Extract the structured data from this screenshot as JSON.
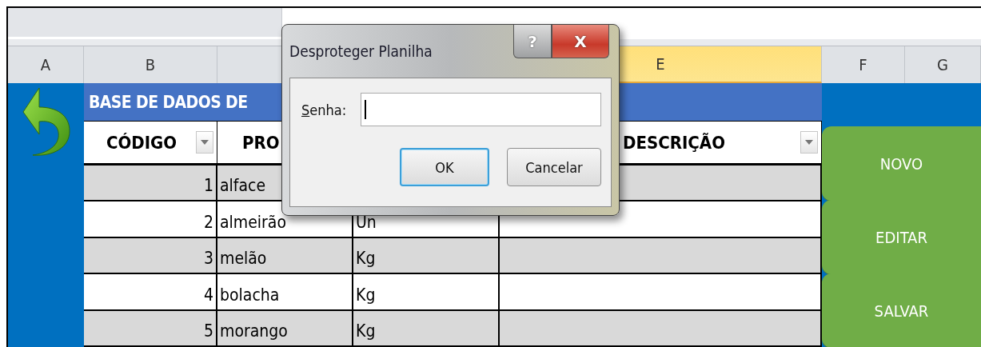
{
  "column_headers": [
    {
      "label": "A",
      "selected": false
    },
    {
      "label": "B",
      "selected": false
    },
    {
      "label": "E",
      "selected": true
    },
    {
      "label": "F",
      "selected": false
    },
    {
      "label": "G",
      "selected": false
    }
  ],
  "sheet": {
    "title": "BASE DE DADOS DE",
    "header": [
      {
        "label": "CÓDIGO",
        "filter": true
      },
      {
        "label": "PRO"
      },
      {
        "label": "DESCRIÇÃO",
        "filter": true
      }
    ],
    "rows": [
      {
        "code": "1",
        "product": "alface"
      },
      {
        "code": "2",
        "product": "almeirão",
        "unit": "Un"
      },
      {
        "code": "3",
        "product": "melão",
        "unit": "Kg"
      },
      {
        "code": "4",
        "product": "bolacha",
        "unit": "Kg"
      },
      {
        "code": "5",
        "product": "morango",
        "unit": "Kg"
      }
    ]
  },
  "buttons": [
    "NOVO",
    "EDITAR",
    "SALVAR"
  ],
  "dialog": {
    "title": "Desproteger Planilha",
    "help_button": "?",
    "close_button": "X",
    "field": {
      "label": "Senha:",
      "focused": true
    },
    "buttons": [
      {
        "label": "OK",
        "default": true
      },
      {
        "label": "Cancelar",
        "default": false
      }
    ]
  }
}
